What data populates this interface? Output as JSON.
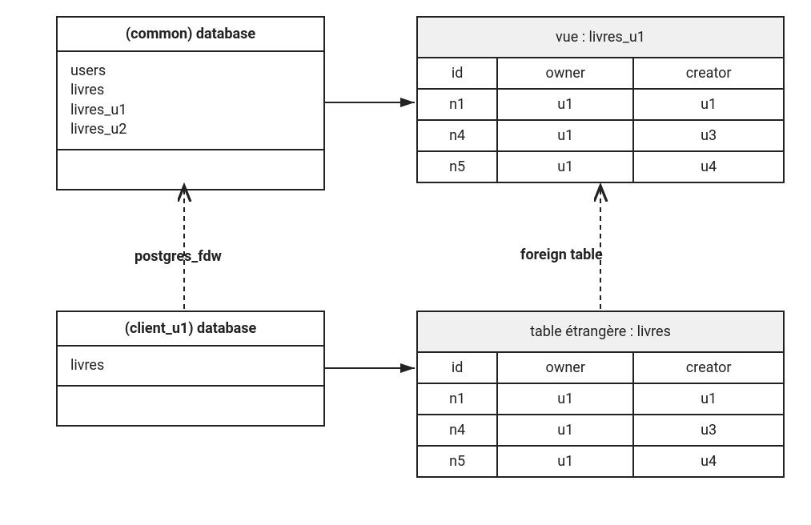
{
  "common_db": {
    "title": "(common) database",
    "items": [
      "users",
      "livres",
      "livres_u1",
      "livres_u2"
    ]
  },
  "client_db": {
    "title": "(client_u1) database",
    "items": [
      "livres"
    ]
  },
  "view_table": {
    "title": "vue : livres_u1",
    "columns": [
      "id",
      "owner",
      "creator"
    ],
    "rows": [
      [
        "n1",
        "u1",
        "u1"
      ],
      [
        "n4",
        "u1",
        "u3"
      ],
      [
        "n5",
        "u1",
        "u4"
      ]
    ]
  },
  "foreign_table": {
    "title": "table étrangère : livres",
    "columns": [
      "id",
      "owner",
      "creator"
    ],
    "rows": [
      [
        "n1",
        "u1",
        "u1"
      ],
      [
        "n4",
        "u1",
        "u3"
      ],
      [
        "n5",
        "u1",
        "u4"
      ]
    ]
  },
  "labels": {
    "postgres_fdw": "postgres_fdw",
    "foreign_table": "foreign table"
  }
}
